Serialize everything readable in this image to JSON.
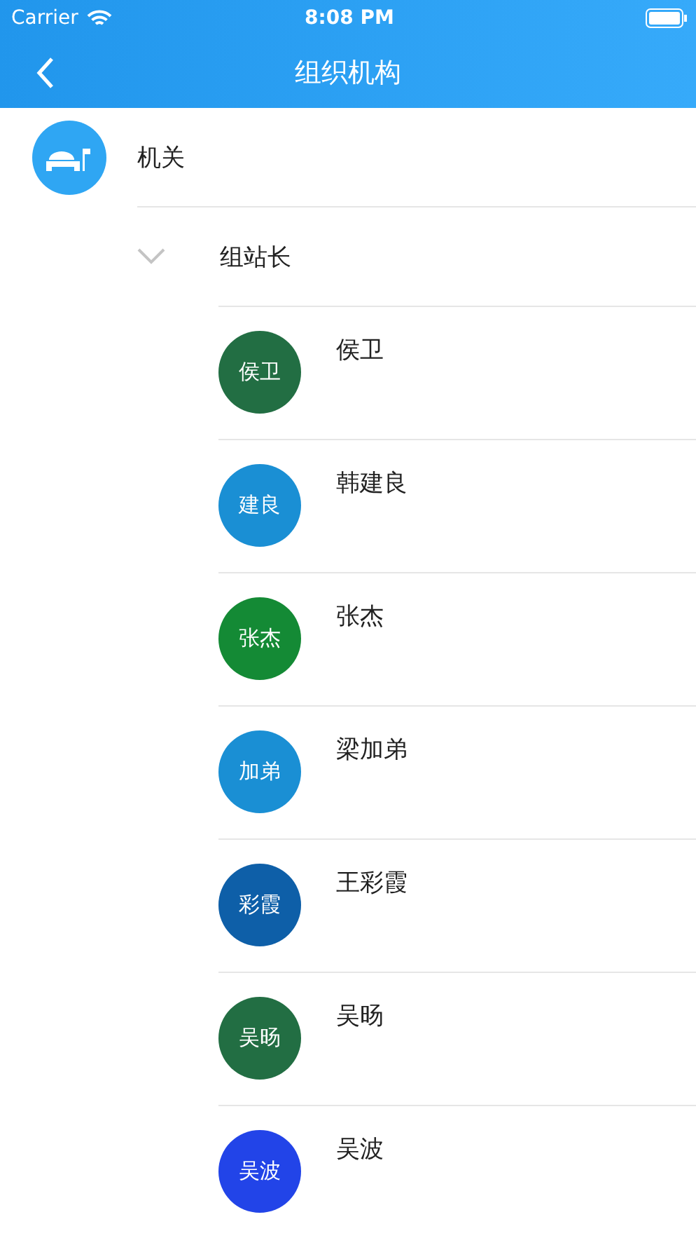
{
  "status_bar": {
    "carrier": "Carrier",
    "time": "8:08 PM"
  },
  "nav_bar": {
    "title": "组织机构"
  },
  "organization": {
    "name": "机关"
  },
  "group": {
    "name": "组站长",
    "expanded": true,
    "members": [
      {
        "name": "侯卫",
        "initials": "侯卫",
        "color": "#226e43"
      },
      {
        "name": "韩建良",
        "initials": "建良",
        "color": "#1a8fd4"
      },
      {
        "name": "张杰",
        "initials": "张杰",
        "color": "#148a35"
      },
      {
        "name": "梁加弟",
        "initials": "加弟",
        "color": "#1a8fd4"
      },
      {
        "name": "王彩霞",
        "initials": "彩霞",
        "color": "#0e5fa8"
      },
      {
        "name": "吴旸",
        "initials": "吴旸",
        "color": "#226e43"
      },
      {
        "name": "吴波",
        "initials": "吴波",
        "color": "#2244e8"
      }
    ]
  }
}
